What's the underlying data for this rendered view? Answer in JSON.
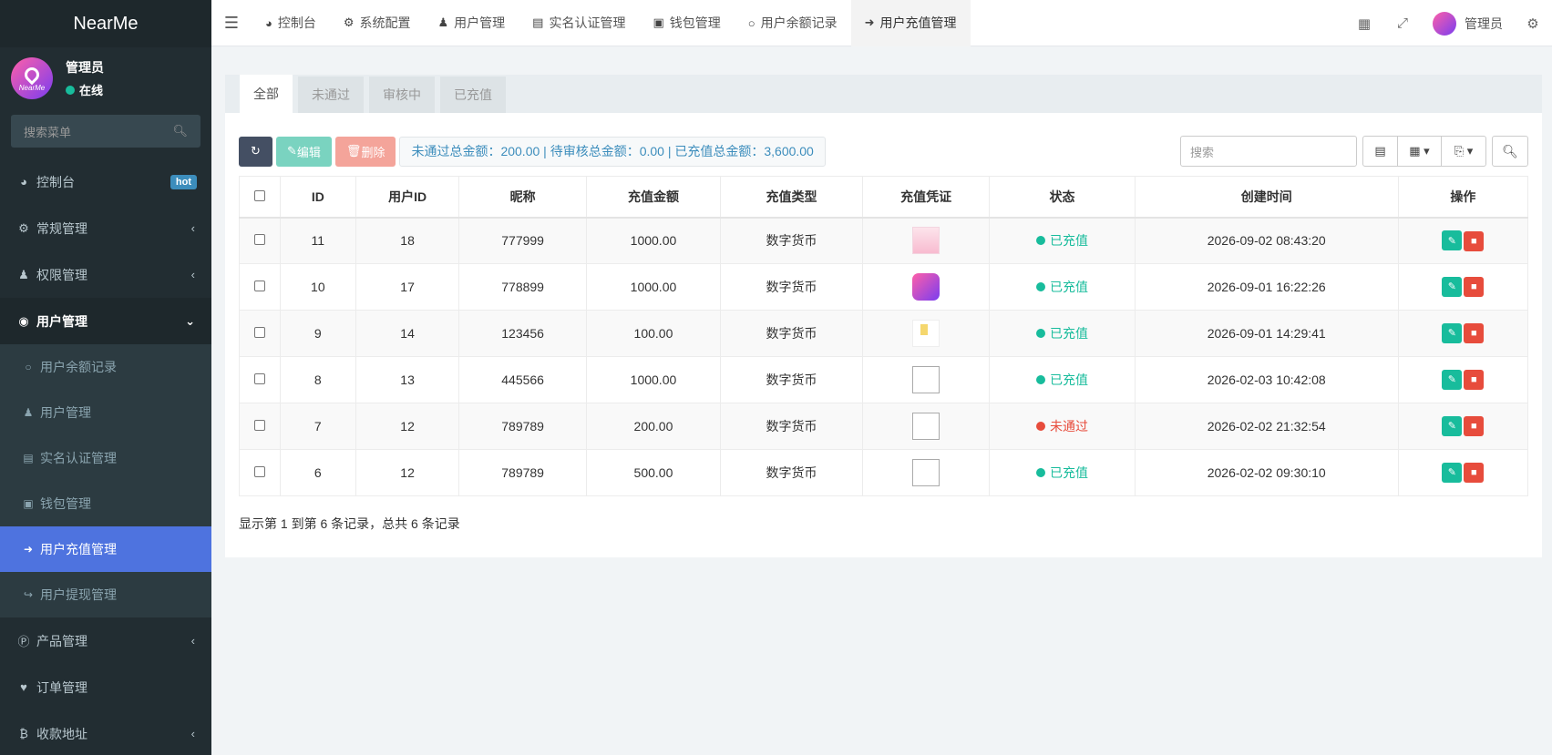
{
  "app": {
    "logo": "NearMe",
    "admin_name": "管理员",
    "online": "在线"
  },
  "sidebar": {
    "search_placeholder": "搜索菜单",
    "items": [
      {
        "label": "控制台",
        "badge": "hot"
      },
      {
        "label": "常规管理"
      },
      {
        "label": "权限管理"
      },
      {
        "label": "用户管理"
      }
    ],
    "sub_items": [
      {
        "label": "用户余额记录"
      },
      {
        "label": "用户管理"
      },
      {
        "label": "实名认证管理"
      },
      {
        "label": "钱包管理"
      },
      {
        "label": "用户充值管理"
      },
      {
        "label": "用户提现管理"
      }
    ],
    "bottom_items": [
      {
        "label": "产品管理"
      },
      {
        "label": "订单管理"
      },
      {
        "label": "收款地址"
      }
    ]
  },
  "topbar": {
    "tabs": [
      {
        "label": "控制台"
      },
      {
        "label": "系统配置"
      },
      {
        "label": "用户管理"
      },
      {
        "label": "实名认证管理"
      },
      {
        "label": "钱包管理"
      },
      {
        "label": "用户余额记录"
      },
      {
        "label": "用户充值管理"
      }
    ],
    "user_label": "管理员"
  },
  "filter_tabs": [
    {
      "label": "全部"
    },
    {
      "label": "未通过"
    },
    {
      "label": "审核中"
    },
    {
      "label": "已充值"
    }
  ],
  "toolbar": {
    "edit_label": "编辑",
    "delete_label": "删除",
    "summary": "未通过总金额：200.00 | 待审核总金额：0.00 | 已充值总金额：3,600.00",
    "search_placeholder": "搜索"
  },
  "table": {
    "headers": [
      "ID",
      "用户ID",
      "昵称",
      "充值金额",
      "充值类型",
      "充值凭证",
      "状态",
      "创建时间",
      "操作"
    ],
    "rows": [
      {
        "id": "11",
        "user_id": "18",
        "nickname": "777999",
        "amount": "1000.00",
        "type": "数字货币",
        "status": "已充值",
        "created": "2026-09-02 08:43:20"
      },
      {
        "id": "10",
        "user_id": "17",
        "nickname": "778899",
        "amount": "1000.00",
        "type": "数字货币",
        "status": "已充值",
        "created": "2026-09-01 16:22:26"
      },
      {
        "id": "9",
        "user_id": "14",
        "nickname": "123456",
        "amount": "100.00",
        "type": "数字货币",
        "status": "已充值",
        "created": "2026-09-01 14:29:41"
      },
      {
        "id": "8",
        "user_id": "13",
        "nickname": "445566",
        "amount": "1000.00",
        "type": "数字货币",
        "status": "已充值",
        "created": "2026-02-03 10:42:08"
      },
      {
        "id": "7",
        "user_id": "12",
        "nickname": "789789",
        "amount": "200.00",
        "type": "数字货币",
        "status": "未通过",
        "created": "2026-02-02 21:32:54"
      },
      {
        "id": "6",
        "user_id": "12",
        "nickname": "789789",
        "amount": "500.00",
        "type": "数字货币",
        "status": "已充值",
        "created": "2026-02-02 09:30:10"
      }
    ]
  },
  "pager_info": "显示第 1 到第 6 条记录，总共 6 条记录"
}
